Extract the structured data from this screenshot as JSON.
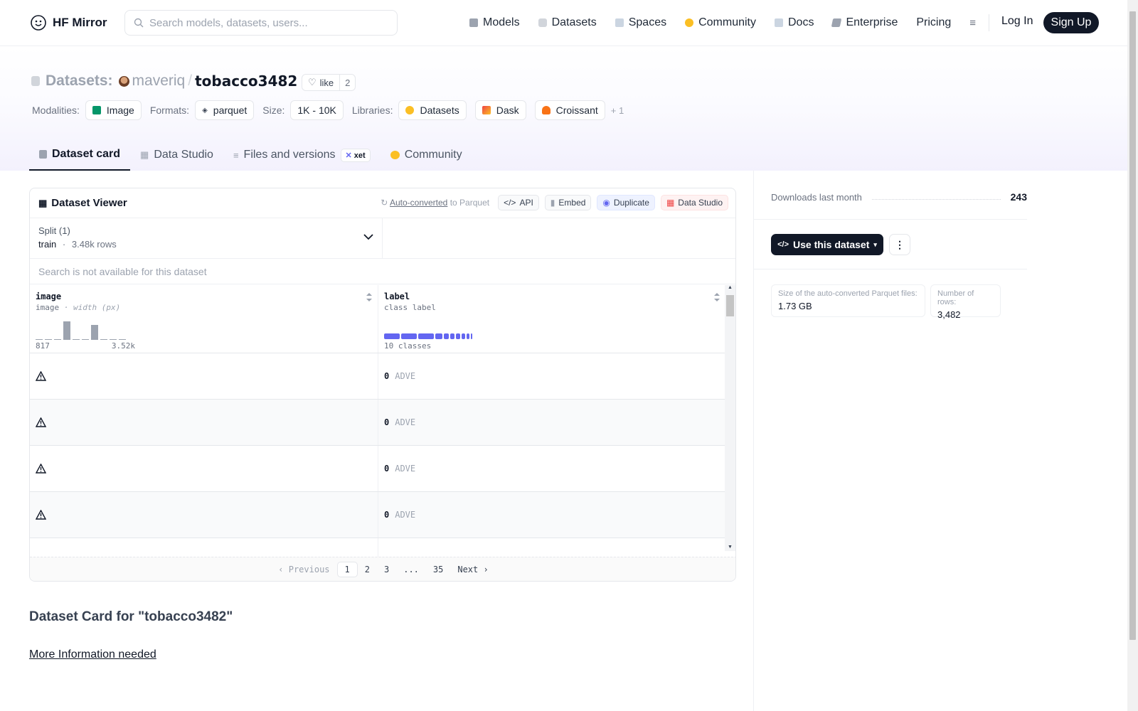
{
  "nav": {
    "brand": "HF Mirror",
    "search_placeholder": "Search models, datasets, users...",
    "links": [
      {
        "label": "Models",
        "icon": "models-icon",
        "color": "#9ca3af"
      },
      {
        "label": "Datasets",
        "icon": "datasets-icon",
        "color": "#d1d5db"
      },
      {
        "label": "Spaces",
        "icon": "spaces-icon",
        "color": "#cbd5e1"
      },
      {
        "label": "Community",
        "icon": "community-icon",
        "color": "#fbbf24"
      },
      {
        "label": "Docs",
        "icon": "docs-icon",
        "color": "#cbd5e1"
      },
      {
        "label": "Enterprise",
        "icon": "enterprise-icon",
        "color": "#9ca3af"
      },
      {
        "label": "Pricing",
        "icon": "",
        "color": ""
      }
    ],
    "login": "Log In",
    "signup": "Sign Up"
  },
  "header": {
    "crumb_label": "Datasets:",
    "user": "maveriq",
    "sep": "/",
    "repo": "tobacco3482",
    "like_label": "like",
    "like_count": "2",
    "modalities_label": "Modalities:",
    "modality": "Image",
    "formats_label": "Formats:",
    "format": "parquet",
    "size_label": "Size:",
    "size": "1K - 10K",
    "libraries_label": "Libraries:",
    "libraries": [
      "Datasets",
      "Dask",
      "Croissant"
    ],
    "libraries_more": "+ 1"
  },
  "tabs": [
    {
      "label": "Dataset card",
      "active": true
    },
    {
      "label": "Data Studio"
    },
    {
      "label": "Files and versions",
      "badge": "xet"
    },
    {
      "label": "Community"
    }
  ],
  "viewer": {
    "title": "Dataset Viewer",
    "auto_converted": "Auto-converted",
    "to_parquet": "to Parquet",
    "api": "API",
    "embed": "Embed",
    "duplicate": "Duplicate",
    "data_studio": "Data Studio",
    "split_label": "Split (1)",
    "split_name": "train",
    "split_dot": "·",
    "split_rows": "3.48k rows",
    "search_disabled": "Search is not available for this dataset",
    "columns": [
      {
        "name": "image",
        "type": "image",
        "type_extra": "· width (px)",
        "min": "817",
        "max": "3.52k",
        "hist": [
          0.05,
          0.05,
          0.05,
          1.0,
          0.05,
          0.05,
          0.8,
          0.05,
          0.05,
          0.05
        ]
      },
      {
        "name": "label",
        "type": "class label",
        "classes": "10 classes",
        "class_widths": [
          0.27,
          0.27,
          0.27,
          0.12,
          0.09,
          0.08,
          0.07,
          0.06,
          0.05,
          0.02
        ]
      }
    ],
    "rows": [
      {
        "image_status": "warning-icon",
        "label_value": "0",
        "label_name": "ADVE"
      },
      {
        "image_status": "warning-icon",
        "label_value": "0",
        "label_name": "ADVE"
      },
      {
        "image_status": "warning-icon",
        "label_value": "0",
        "label_name": "ADVE"
      },
      {
        "image_status": "warning-icon",
        "label_value": "0",
        "label_name": "ADVE"
      }
    ],
    "pager": {
      "previous": "Previous",
      "pages": [
        "1",
        "2",
        "3",
        "...",
        "35"
      ],
      "next": "Next"
    }
  },
  "card": {
    "heading": "Dataset Card for \"tobacco3482\"",
    "more_info": "More Information needed"
  },
  "sidebar": {
    "downloads_label": "Downloads last month",
    "downloads": "243",
    "use_button": "Use this dataset",
    "parquet_size_label": "Size of the auto-converted Parquet files:",
    "parquet_size": "1.73 GB",
    "rows_label": "Number of rows:",
    "rows": "3,482"
  }
}
